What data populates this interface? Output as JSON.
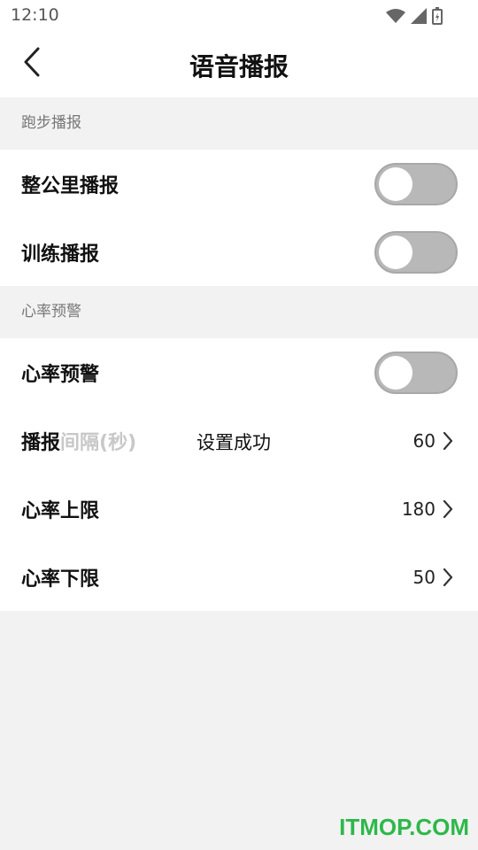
{
  "status_bar": {
    "time": "12:10"
  },
  "nav": {
    "title": "语音播报"
  },
  "sections": [
    {
      "header": "跑步播报",
      "rows": [
        {
          "label": "整公里播报",
          "toggle": false
        },
        {
          "label": "训练播报",
          "toggle": false
        }
      ]
    },
    {
      "header": "心率预警",
      "rows": [
        {
          "label": "心率预警",
          "toggle": false
        },
        {
          "label_visible": "播报",
          "label_faded": "间隔(秒)",
          "value": "60"
        },
        {
          "label": "心率上限",
          "value": "180"
        },
        {
          "label": "心率下限",
          "value": "50"
        }
      ]
    }
  ],
  "toast": {
    "text": "设置成功"
  },
  "watermark": "ITMOP.COM",
  "colors": {
    "toggle_off": "#b8b8b8",
    "watermark": "#2db84a"
  }
}
